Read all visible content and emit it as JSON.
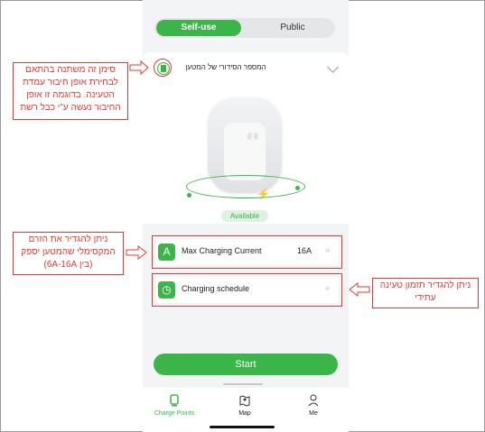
{
  "tabs": {
    "self_use": "Self-use",
    "public": "Public"
  },
  "charger": {
    "serial_label": "המספר הסידורי של המטען",
    "status": "Available",
    "nfc": "((·))",
    "bolt": "⚡"
  },
  "settings": [
    {
      "icon_text": "A",
      "label": "Max Charging Current",
      "value": "16A",
      "arrow": "»"
    },
    {
      "icon_text": "◷",
      "label": "Charging schedule",
      "value": "",
      "arrow": "»"
    }
  ],
  "start_button": "Start",
  "bottom_nav": [
    {
      "label": "Charge Points",
      "icon": "charger-icon",
      "active": true
    },
    {
      "label": "Map",
      "icon": "map-icon",
      "active": false
    },
    {
      "label": "Me",
      "icon": "person-icon",
      "active": false
    }
  ],
  "annotations": {
    "icon_note": "סימן זה משתנה בהתאם לבחירת אופן חיבור עמדת הטעינה. בדוגמה זו אופן החיבור נעשה ע\"י כבל רשת",
    "current_note": "ניתן להגדיר את הזרם המקסימלי שהמטען יספק (בין 6A-16A)",
    "schedule_note": "ניתן להגדיר תזמון טעינה עתידי"
  },
  "colors": {
    "accent": "#3bb54a",
    "annotation": "#e53935"
  }
}
